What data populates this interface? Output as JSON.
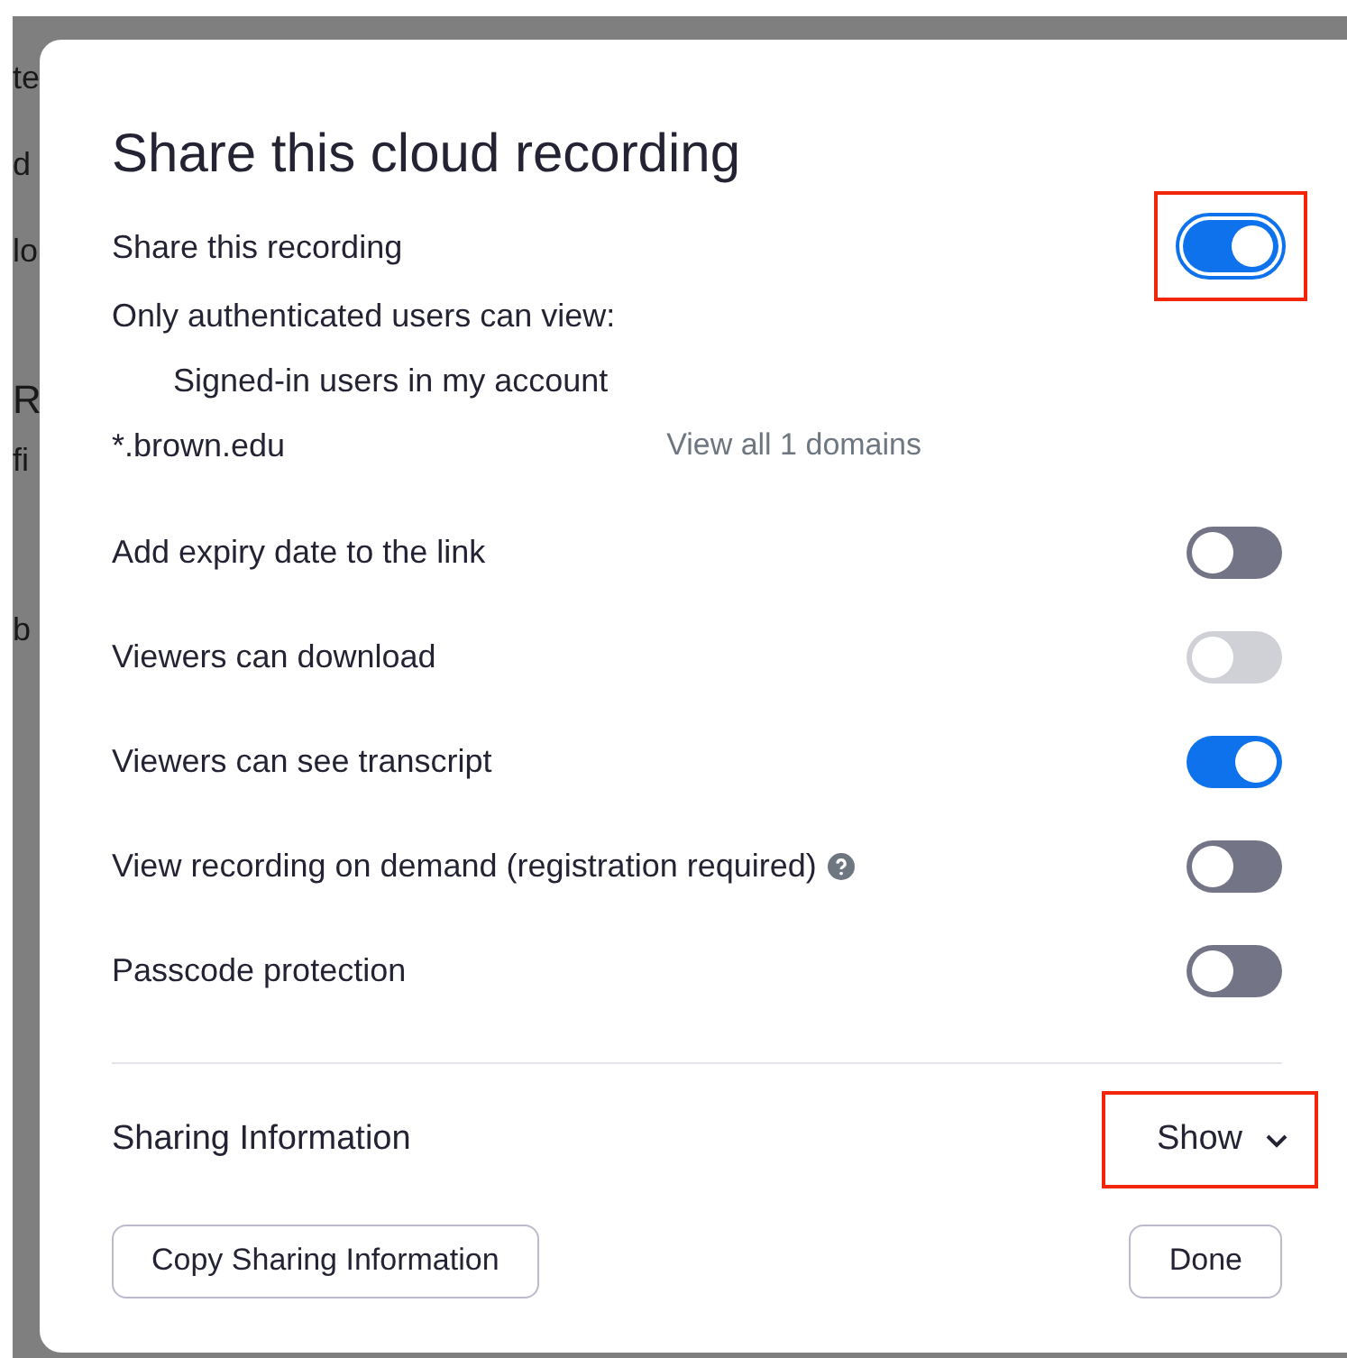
{
  "background_fragments": [
    "te",
    "d",
    "lo",
    "R",
    "fi",
    "b"
  ],
  "dialog": {
    "title": "Share this cloud recording",
    "share": {
      "label": "Share this recording",
      "on": true,
      "highlighted": true
    },
    "auth_label": "Only authenticated users can view:",
    "auth_option": "Signed-in users in my account",
    "domain": "*.brown.edu",
    "domain_link": "View all 1 domains",
    "options": [
      {
        "label": "Add expiry date to the link",
        "on": false,
        "disabled": false
      },
      {
        "label": "Viewers can download",
        "on": false,
        "disabled": true
      },
      {
        "label": "Viewers can see transcript",
        "on": true,
        "disabled": false
      },
      {
        "label": "View recording on demand (registration required)",
        "on": false,
        "disabled": false,
        "help": true
      },
      {
        "label": "Passcode protection",
        "on": false,
        "disabled": false
      }
    ],
    "sharing_info": {
      "label": "Sharing Information",
      "toggle": "Show",
      "expanded": false,
      "highlighted": true
    },
    "buttons": [
      "Copy Sharing Information",
      "Done"
    ]
  }
}
